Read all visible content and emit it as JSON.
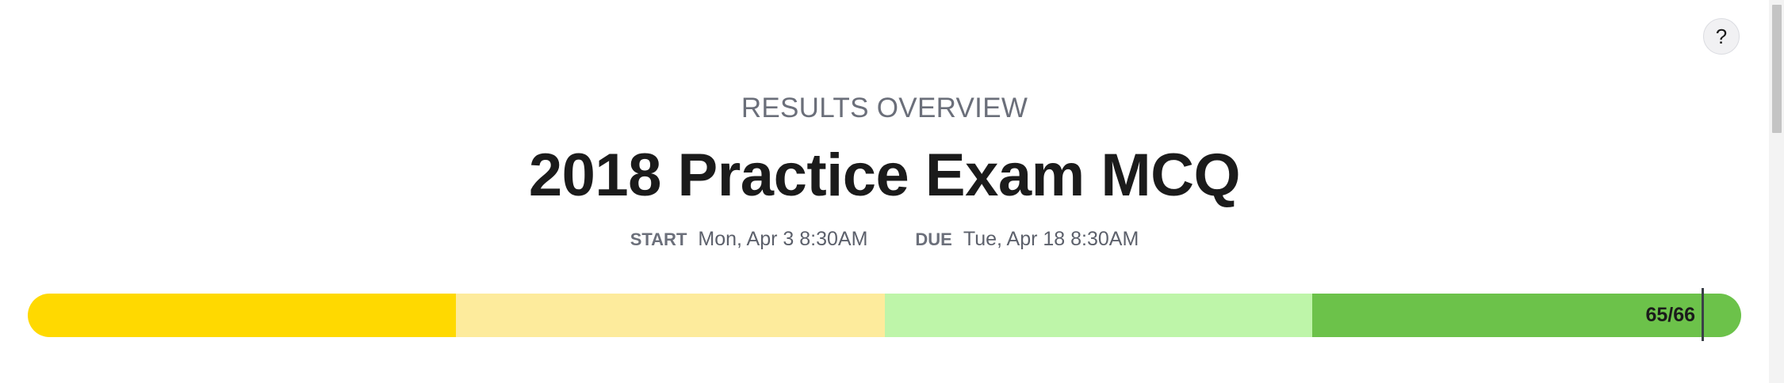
{
  "help": {
    "label": "?"
  },
  "header": {
    "eyebrow": "RESULTS OVERVIEW",
    "title": "2018 Practice Exam MCQ",
    "start_label": "START",
    "start_value": "Mon, Apr 3 8:30AM",
    "due_label": "DUE",
    "due_value": "Tue, Apr 18 8:30AM"
  },
  "progress": {
    "score_label": "65/66",
    "score": 65,
    "total": 66,
    "segments": [
      {
        "color": "#ffd900"
      },
      {
        "color": "#fdeb9c"
      },
      {
        "color": "#bef5a9"
      },
      {
        "color": "#6cc24a"
      }
    ]
  }
}
